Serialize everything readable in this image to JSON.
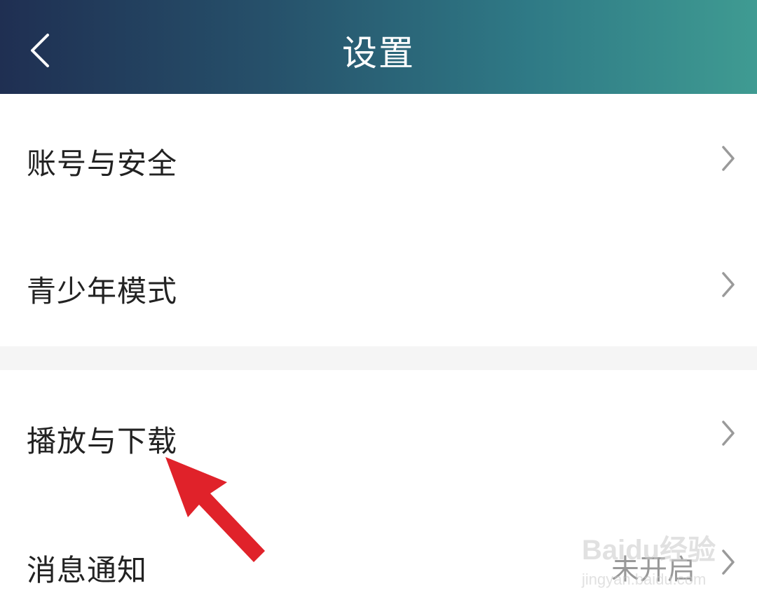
{
  "header": {
    "title": "设置",
    "back_icon": "chevron-left-icon",
    "colors": {
      "gradient_start": "#1f2f52",
      "gradient_end": "#3f9b92"
    }
  },
  "settings": {
    "group1": [
      {
        "label": "账号与安全",
        "icon": "chevron-right-icon"
      },
      {
        "label": "青少年模式",
        "icon": "chevron-right-icon"
      }
    ],
    "group2": [
      {
        "label": "播放与下载",
        "icon": "chevron-right-icon"
      },
      {
        "label": "消息通知",
        "value": "未开启",
        "icon": "chevron-right-icon"
      }
    ]
  },
  "annotation": {
    "arrow_color": "#e0222a"
  },
  "watermark": {
    "brand": "Baidu经验",
    "url": "jingyan.baidu.com"
  }
}
